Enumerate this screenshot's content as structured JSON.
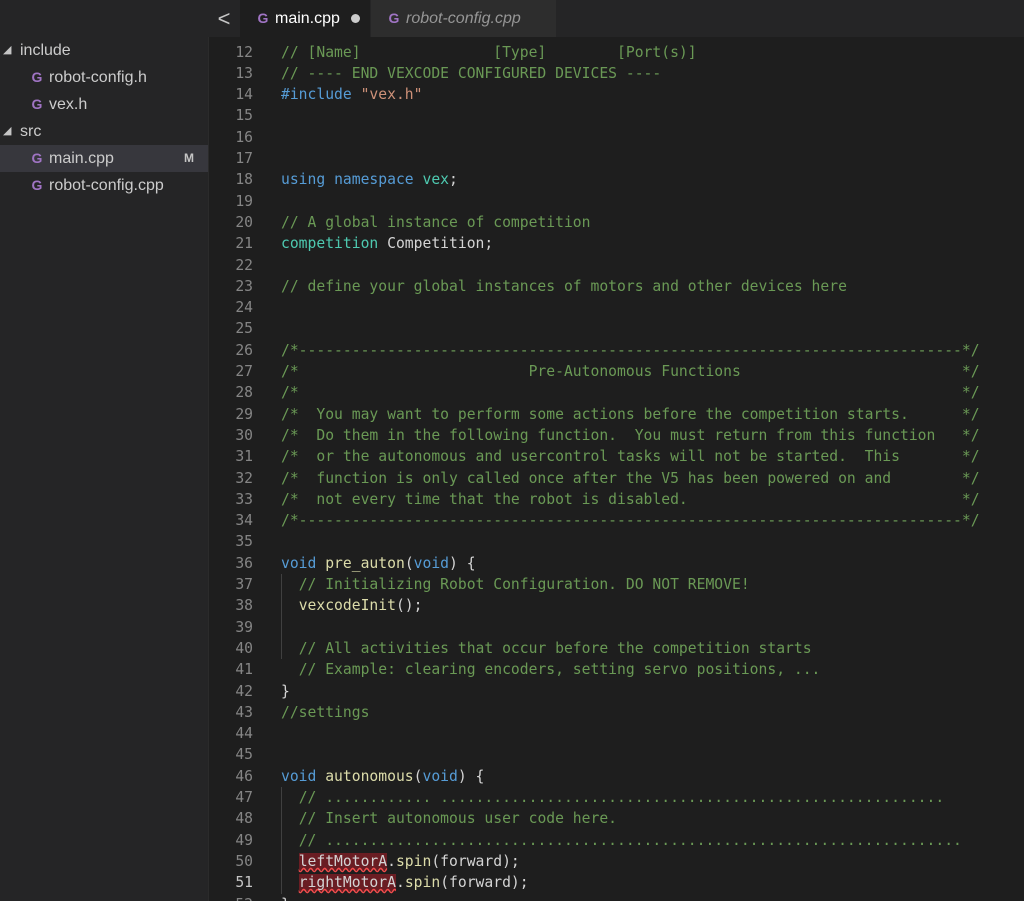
{
  "explorer": {
    "folders": [
      {
        "name": "include",
        "files": [
          {
            "name": "robot-config.h",
            "badge": ""
          },
          {
            "name": "vex.h",
            "badge": ""
          }
        ]
      },
      {
        "name": "src",
        "files": [
          {
            "name": "main.cpp",
            "badge": "M"
          },
          {
            "name": "robot-config.cpp",
            "badge": ""
          }
        ]
      }
    ],
    "expanded_glyph": "◢",
    "file_icon": "c-plus-plus-icon",
    "icon_glyph": "G",
    "selected_file": "main.cpp"
  },
  "tabs": [
    {
      "label": "main.cpp",
      "active": true,
      "dirty": true
    },
    {
      "label": "robot-config.cpp",
      "active": false,
      "dirty": false,
      "preview": true
    }
  ],
  "back_glyph": "<",
  "editor": {
    "current_line": 51,
    "lines": [
      {
        "n": 12,
        "t": [
          {
            "k": "comment",
            "s": "// [Name]               [Type]        [Port(s)]"
          }
        ]
      },
      {
        "n": 13,
        "t": [
          {
            "k": "comment",
            "s": "// ---- END VEXCODE CONFIGURED DEVICES ----"
          }
        ]
      },
      {
        "n": 14,
        "t": [
          {
            "k": "keyword",
            "s": "#include"
          },
          {
            "k": "ident",
            "s": " "
          },
          {
            "k": "string",
            "s": "\"vex.h\""
          }
        ]
      },
      {
        "n": 15,
        "t": []
      },
      {
        "n": 16,
        "t": []
      },
      {
        "n": 17,
        "t": []
      },
      {
        "n": 18,
        "t": [
          {
            "k": "keyword",
            "s": "using"
          },
          {
            "k": "ident",
            "s": " "
          },
          {
            "k": "keyword",
            "s": "namespace"
          },
          {
            "k": "ident",
            "s": " "
          },
          {
            "k": "type",
            "s": "vex"
          },
          {
            "k": "ident",
            "s": ";"
          }
        ]
      },
      {
        "n": 19,
        "t": []
      },
      {
        "n": 20,
        "t": [
          {
            "k": "comment",
            "s": "// A global instance of competition"
          }
        ]
      },
      {
        "n": 21,
        "t": [
          {
            "k": "type",
            "s": "competition"
          },
          {
            "k": "ident",
            "s": " Competition;"
          }
        ]
      },
      {
        "n": 22,
        "t": []
      },
      {
        "n": 23,
        "t": [
          {
            "k": "comment",
            "s": "// define your global instances of motors and other devices here"
          }
        ]
      },
      {
        "n": 24,
        "t": []
      },
      {
        "n": 25,
        "t": []
      },
      {
        "n": 26,
        "t": [
          {
            "k": "comment",
            "s": "/*---------------------------------------------------------------------------*/"
          }
        ]
      },
      {
        "n": 27,
        "t": [
          {
            "k": "comment",
            "s": "/*                          Pre-Autonomous Functions                         */"
          }
        ]
      },
      {
        "n": 28,
        "t": [
          {
            "k": "comment",
            "s": "/*                                                                           */"
          }
        ]
      },
      {
        "n": 29,
        "t": [
          {
            "k": "comment",
            "s": "/*  You may want to perform some actions before the competition starts.      */"
          }
        ]
      },
      {
        "n": 30,
        "t": [
          {
            "k": "comment",
            "s": "/*  Do them in the following function.  You must return from this function   */"
          }
        ]
      },
      {
        "n": 31,
        "t": [
          {
            "k": "comment",
            "s": "/*  or the autonomous and usercontrol tasks will not be started.  This       */"
          }
        ]
      },
      {
        "n": 32,
        "t": [
          {
            "k": "comment",
            "s": "/*  function is only called once after the V5 has been powered on and        */"
          }
        ]
      },
      {
        "n": 33,
        "t": [
          {
            "k": "comment",
            "s": "/*  not every time that the robot is disabled.                               */"
          }
        ]
      },
      {
        "n": 34,
        "t": [
          {
            "k": "comment",
            "s": "/*---------------------------------------------------------------------------*/"
          }
        ]
      },
      {
        "n": 35,
        "t": []
      },
      {
        "n": 36,
        "t": [
          {
            "k": "keyword",
            "s": "void"
          },
          {
            "k": "ident",
            "s": " "
          },
          {
            "k": "func",
            "s": "pre_auton"
          },
          {
            "k": "ident",
            "s": "("
          },
          {
            "k": "keyword",
            "s": "void"
          },
          {
            "k": "ident",
            "s": ") {"
          }
        ]
      },
      {
        "n": 37,
        "t": [
          {
            "k": "ident",
            "s": "  "
          },
          {
            "k": "comment",
            "s": "// Initializing Robot Configuration. DO NOT REMOVE!"
          }
        ]
      },
      {
        "n": 38,
        "t": [
          {
            "k": "ident",
            "s": "  "
          },
          {
            "k": "func",
            "s": "vexcodeInit"
          },
          {
            "k": "ident",
            "s": "();"
          }
        ]
      },
      {
        "n": 39,
        "t": []
      },
      {
        "n": 40,
        "t": [
          {
            "k": "ident",
            "s": "  "
          },
          {
            "k": "comment",
            "s": "// All activities that occur before the competition starts"
          }
        ]
      },
      {
        "n": 41,
        "t": [
          {
            "k": "ident",
            "s": "  "
          },
          {
            "k": "comment",
            "s": "// Example: clearing encoders, setting servo positions, ..."
          }
        ]
      },
      {
        "n": 42,
        "t": [
          {
            "k": "ident",
            "s": "}"
          }
        ]
      },
      {
        "n": 43,
        "t": [
          {
            "k": "comment",
            "s": "//settings"
          }
        ]
      },
      {
        "n": 44,
        "t": []
      },
      {
        "n": 45,
        "t": []
      },
      {
        "n": 46,
        "t": [
          {
            "k": "keyword",
            "s": "void"
          },
          {
            "k": "ident",
            "s": " "
          },
          {
            "k": "func",
            "s": "autonomous"
          },
          {
            "k": "ident",
            "s": "("
          },
          {
            "k": "keyword",
            "s": "void"
          },
          {
            "k": "ident",
            "s": ") {"
          }
        ]
      },
      {
        "n": 47,
        "t": [
          {
            "k": "ident",
            "s": "  "
          },
          {
            "k": "comment",
            "s": "// ............ ........................................................."
          }
        ]
      },
      {
        "n": 48,
        "t": [
          {
            "k": "ident",
            "s": "  "
          },
          {
            "k": "comment",
            "s": "// Insert autonomous user code here."
          }
        ]
      },
      {
        "n": 49,
        "t": [
          {
            "k": "ident",
            "s": "  "
          },
          {
            "k": "comment",
            "s": "// ........................................................................"
          }
        ]
      },
      {
        "n": 50,
        "t": [
          {
            "k": "ident",
            "s": "  "
          },
          {
            "k": "err",
            "s": "leftMotorA"
          },
          {
            "k": "ident",
            "s": "."
          },
          {
            "k": "func",
            "s": "spin"
          },
          {
            "k": "ident",
            "s": "(forward);"
          }
        ]
      },
      {
        "n": 51,
        "t": [
          {
            "k": "ident",
            "s": "  "
          },
          {
            "k": "err",
            "s": "rightMotorA"
          },
          {
            "k": "ident",
            "s": "."
          },
          {
            "k": "func",
            "s": "spin"
          },
          {
            "k": "ident",
            "s": "(forward);"
          }
        ]
      },
      {
        "n": 52,
        "t": [
          {
            "k": "ident",
            "s": "}"
          }
        ]
      }
    ]
  },
  "colors": {
    "background": "#1e1e1e",
    "sidebar": "#252526",
    "comment": "#6a9955",
    "keyword": "#569cd6",
    "type": "#4ec9b0",
    "string": "#ce9178",
    "function": "#dcdcaa",
    "error": "#f14c4c",
    "cpp_icon": "#a074c4"
  }
}
